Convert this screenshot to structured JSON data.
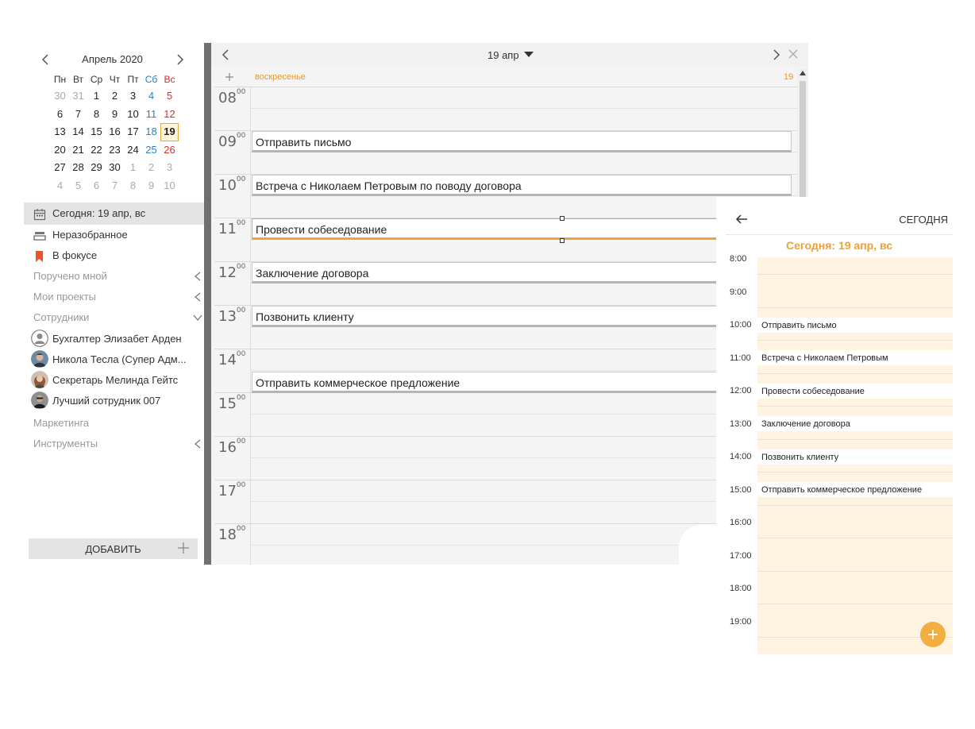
{
  "calendar": {
    "month_title": "Апрель 2020",
    "weekdays": [
      "Пн",
      "Вт",
      "Ср",
      "Чт",
      "Пт",
      "Сб",
      "Вс"
    ],
    "weeks": [
      [
        "30",
        "31",
        "1",
        "2",
        "3",
        "4",
        "5"
      ],
      [
        "6",
        "7",
        "8",
        "9",
        "10",
        "11",
        "12"
      ],
      [
        "13",
        "14",
        "15",
        "16",
        "17",
        "18",
        "19"
      ],
      [
        "20",
        "21",
        "22",
        "23",
        "24",
        "25",
        "26"
      ],
      [
        "27",
        "28",
        "29",
        "30",
        "1",
        "2",
        "3"
      ],
      [
        "4",
        "5",
        "6",
        "7",
        "8",
        "9",
        "10"
      ]
    ],
    "selected_day": "19"
  },
  "sidebar": {
    "today": "Сегодня: 19 апр, вс",
    "inbox": "Неразобранное",
    "focus": "В фокусе",
    "assigned_by_me": "Поручено мной",
    "my_projects": "Мои проекты",
    "employees": "Сотрудники",
    "employee_list": [
      "Бухгалтер Элизабет Арден",
      "Никола Тесла (Супер Адм...",
      "Секретарь Мелинда Гейтс",
      "Лучший сотрудник 007"
    ],
    "marketing": "Маркетинга",
    "tools": "Инструменты",
    "add_button": "ДОБАВИТЬ"
  },
  "day_view": {
    "date_label": "19 апр",
    "weekday_label": "воскресенье",
    "day_number": "19",
    "hours": [
      "08",
      "09",
      "10",
      "11",
      "12",
      "13",
      "14",
      "15",
      "16",
      "17",
      "18"
    ],
    "minutes_suffix": "00",
    "events": [
      {
        "title": "Отправить письмо",
        "hour": 9
      },
      {
        "title": "Встреча с Николаем Петровым по поводу договора",
        "hour": 10
      },
      {
        "title": "Провести собеседование",
        "hour": 11,
        "selected": true
      },
      {
        "title": "Заключение договора",
        "hour": 12
      },
      {
        "title": "Позвонить клиенту",
        "hour": 13
      },
      {
        "title": "Отправить коммерческое предложение",
        "hour": 14.5
      }
    ]
  },
  "mobile": {
    "header_title": "СЕГОДНЯ",
    "date_heading": "Сегодня: 19 апр, вс",
    "hours": [
      "8:00",
      "9:00",
      "10:00",
      "11:00",
      "12:00",
      "13:00",
      "14:00",
      "15:00",
      "16:00",
      "17:00",
      "18:00",
      "19:00"
    ],
    "events": [
      {
        "title": "Отправить письмо",
        "hour": 9
      },
      {
        "title": "Встреча с Николаем Петровым",
        "hour": 10
      },
      {
        "title": "Провести собеседование",
        "hour": 11
      },
      {
        "title": "Заключение договора",
        "hour": 12
      },
      {
        "title": "Позвонить клиенту",
        "hour": 13
      },
      {
        "title": "Отправить коммерческое предложение",
        "hour": 14
      }
    ]
  },
  "colors": {
    "accent": "#f0a033",
    "saturday": "#2a7fc0",
    "sunday": "#d0302a"
  }
}
